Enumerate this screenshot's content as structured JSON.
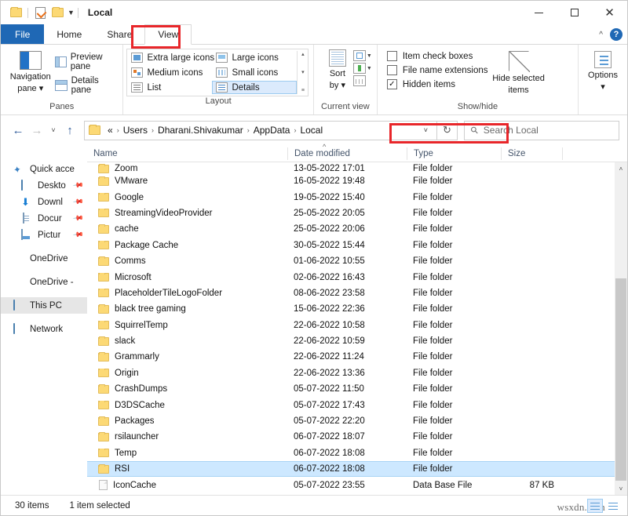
{
  "window": {
    "title": "Local",
    "minimize_label": "─",
    "maximize_label": "☐",
    "close_label": "✕"
  },
  "quick_access_toolbar": {
    "items": [
      "folder-icon",
      "properties-icon",
      "new-folder-icon",
      "customize-caret"
    ]
  },
  "tabs": [
    {
      "label": "File",
      "id": "file"
    },
    {
      "label": "Home",
      "id": "home"
    },
    {
      "label": "Share",
      "id": "share"
    },
    {
      "label": "View",
      "id": "view",
      "active": true,
      "highlighted": true
    }
  ],
  "ribbon": {
    "groups": [
      {
        "name": "Panes",
        "label": "Panes",
        "big_button": {
          "line1": "Navigation",
          "line2": "pane ▾"
        },
        "small_buttons": [
          {
            "label": "Preview pane"
          },
          {
            "label": "Details pane"
          }
        ]
      },
      {
        "name": "Layout",
        "label": "Layout",
        "options": [
          {
            "label": "Extra large icons",
            "selected": false
          },
          {
            "label": "Large icons",
            "selected": false
          },
          {
            "label": "Medium icons",
            "selected": false
          },
          {
            "label": "Small icons",
            "selected": false
          },
          {
            "label": "List",
            "selected": false
          },
          {
            "label": "Details",
            "selected": true
          }
        ],
        "scroll": [
          "▴",
          "▾",
          "≡"
        ]
      },
      {
        "name": "Current view",
        "label": "Current view",
        "sort_by": {
          "line1": "Sort",
          "line2": "by ▾"
        }
      },
      {
        "name": "Show/hide",
        "label": "Show/hide",
        "checkboxes": [
          {
            "label": "Item check boxes",
            "checked": false
          },
          {
            "label": "File name extensions",
            "checked": false
          },
          {
            "label": "Hidden items",
            "checked": true,
            "highlighted": true
          }
        ],
        "hide_selected": {
          "line1": "Hide selected",
          "line2": "items"
        }
      },
      {
        "name": "Options",
        "label": "",
        "button": {
          "line1": "Options",
          "line2": "▾"
        }
      }
    ]
  },
  "navigation": {
    "back_label": "←",
    "forward_label": "→",
    "recent_label": "˅",
    "up_label": "↑",
    "refresh_label": "↻",
    "address_caret": "˅",
    "breadcrumbs": [
      "«",
      "Users",
      "Dharani.Shivakumar",
      "AppData",
      "Local"
    ],
    "separator": "›"
  },
  "search": {
    "placeholder": "Search Local",
    "icon": "search-icon"
  },
  "sidebar": {
    "items": [
      {
        "label": "Quick acce",
        "icon": "star-icon",
        "level": 0,
        "pinned": false
      },
      {
        "label": "Deskto",
        "icon": "desktop-icon",
        "level": 1,
        "pinned": true
      },
      {
        "label": "Downl",
        "icon": "downloads-icon",
        "level": 1,
        "pinned": true
      },
      {
        "label": "Docur",
        "icon": "documents-icon",
        "level": 1,
        "pinned": true
      },
      {
        "label": "Pictur",
        "icon": "pictures-icon",
        "level": 1,
        "pinned": true
      },
      {
        "label": "OneDrive",
        "icon": "onedrive-icon",
        "level": 0,
        "pinned": false,
        "gap_before": true
      },
      {
        "label": "OneDrive -",
        "icon": "onedrive-icon",
        "level": 0,
        "pinned": false,
        "gap_before": true
      },
      {
        "label": "This PC",
        "icon": "this-pc-icon",
        "level": 0,
        "pinned": false,
        "gap_before": true,
        "selected": true
      },
      {
        "label": "Network",
        "icon": "network-icon",
        "level": 0,
        "pinned": false,
        "gap_before": true
      }
    ]
  },
  "file_list": {
    "columns": [
      {
        "key": "name",
        "label": "Name"
      },
      {
        "key": "date",
        "label": "Date modified",
        "sorted": "asc"
      },
      {
        "key": "type",
        "label": "Type"
      },
      {
        "key": "size",
        "label": "Size"
      }
    ],
    "rows": [
      {
        "name": "Zoom",
        "date": "13-05-2022 17:01",
        "type": "File folder",
        "size": "",
        "icon": "folder-icon",
        "partial": true
      },
      {
        "name": "VMware",
        "date": "16-05-2022 19:48",
        "type": "File folder",
        "size": "",
        "icon": "folder-icon"
      },
      {
        "name": "Google",
        "date": "19-05-2022 15:40",
        "type": "File folder",
        "size": "",
        "icon": "folder-icon"
      },
      {
        "name": "StreamingVideoProvider",
        "date": "25-05-2022 20:05",
        "type": "File folder",
        "size": "",
        "icon": "folder-icon"
      },
      {
        "name": "cache",
        "date": "25-05-2022 20:06",
        "type": "File folder",
        "size": "",
        "icon": "folder-icon"
      },
      {
        "name": "Package Cache",
        "date": "30-05-2022 15:44",
        "type": "File folder",
        "size": "",
        "icon": "folder-icon"
      },
      {
        "name": "Comms",
        "date": "01-06-2022 10:55",
        "type": "File folder",
        "size": "",
        "icon": "folder-icon"
      },
      {
        "name": "Microsoft",
        "date": "02-06-2022 16:43",
        "type": "File folder",
        "size": "",
        "icon": "folder-icon"
      },
      {
        "name": "PlaceholderTileLogoFolder",
        "date": "08-06-2022 23:58",
        "type": "File folder",
        "size": "",
        "icon": "folder-icon"
      },
      {
        "name": "black tree gaming",
        "date": "15-06-2022 22:36",
        "type": "File folder",
        "size": "",
        "icon": "folder-icon"
      },
      {
        "name": "SquirrelTemp",
        "date": "22-06-2022 10:58",
        "type": "File folder",
        "size": "",
        "icon": "folder-icon"
      },
      {
        "name": "slack",
        "date": "22-06-2022 10:59",
        "type": "File folder",
        "size": "",
        "icon": "folder-icon"
      },
      {
        "name": "Grammarly",
        "date": "22-06-2022 11:24",
        "type": "File folder",
        "size": "",
        "icon": "folder-icon"
      },
      {
        "name": "Origin",
        "date": "22-06-2022 13:36",
        "type": "File folder",
        "size": "",
        "icon": "folder-icon"
      },
      {
        "name": "CrashDumps",
        "date": "05-07-2022 11:50",
        "type": "File folder",
        "size": "",
        "icon": "folder-icon"
      },
      {
        "name": "D3DSCache",
        "date": "05-07-2022 17:43",
        "type": "File folder",
        "size": "",
        "icon": "folder-icon"
      },
      {
        "name": "Packages",
        "date": "05-07-2022 22:20",
        "type": "File folder",
        "size": "",
        "icon": "folder-icon"
      },
      {
        "name": "rsilauncher",
        "date": "06-07-2022 18:07",
        "type": "File folder",
        "size": "",
        "icon": "folder-icon"
      },
      {
        "name": "Temp",
        "date": "06-07-2022 18:08",
        "type": "File folder",
        "size": "",
        "icon": "folder-icon"
      },
      {
        "name": "RSI",
        "date": "06-07-2022 18:08",
        "type": "File folder",
        "size": "",
        "icon": "folder-icon",
        "selected": true
      },
      {
        "name": "IconCache",
        "date": "05-07-2022 23:55",
        "type": "Data Base File",
        "size": "87 KB",
        "icon": "file-icon"
      }
    ],
    "scrollbar": {
      "up_arrow": "˄",
      "down_arrow": "˅"
    }
  },
  "status_bar": {
    "item_count": "30 items",
    "selection": "1 item selected",
    "view_buttons": [
      "details-view-button",
      "large-icons-view-button"
    ]
  },
  "watermark": "wsxdn.com",
  "colors": {
    "accent": "#1f68b5",
    "selection": "#cde8ff",
    "annotation": "#e8262a",
    "folder": "#fcd975"
  }
}
